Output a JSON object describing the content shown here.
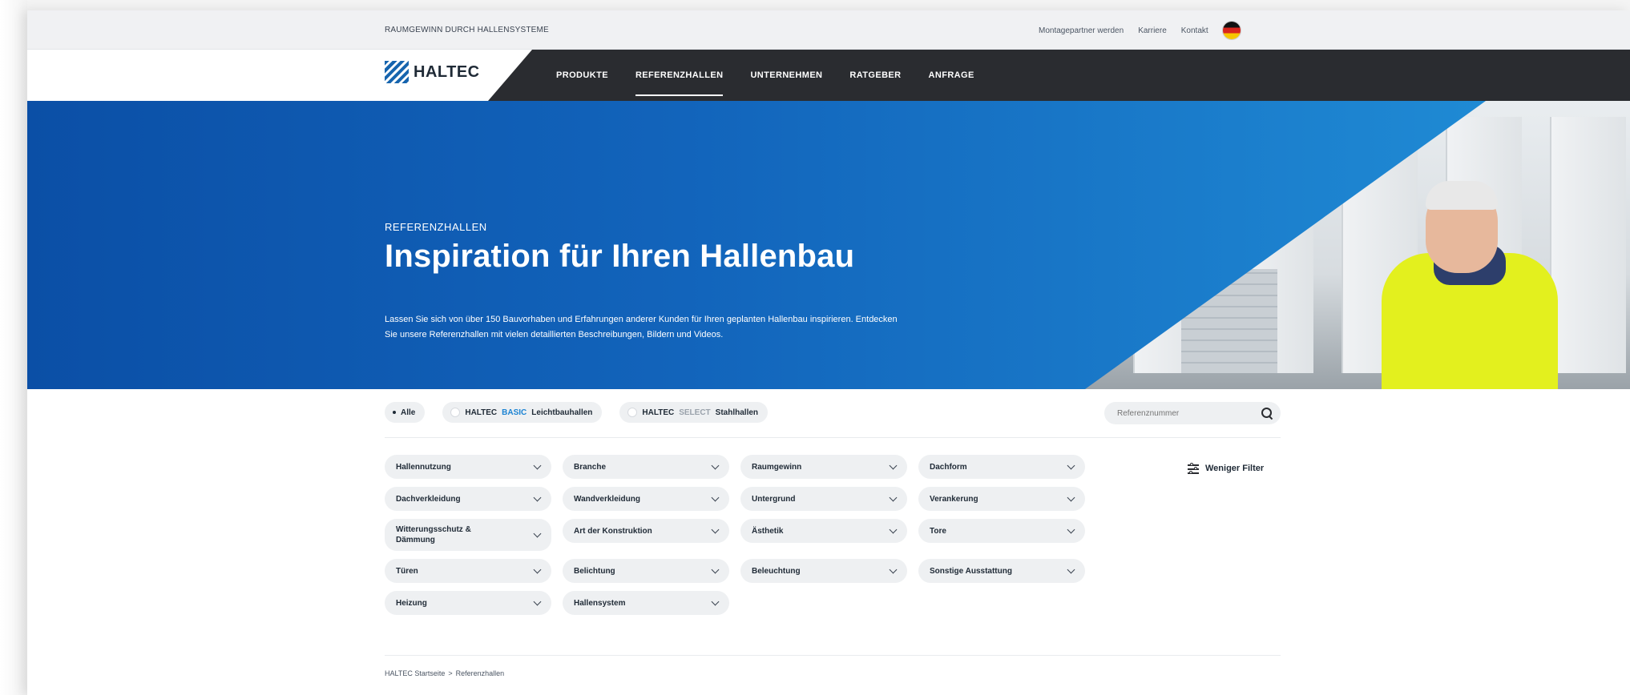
{
  "topbar": {
    "tagline": "RAUMGEWINN DURCH HALLENSYSTEME",
    "links": [
      "Montagepartner werden",
      "Karriere",
      "Kontakt"
    ]
  },
  "nav": {
    "logo_text": "HALTEC",
    "items": [
      "PRODUKTE",
      "REFERENZHALLEN",
      "UNTERNEHMEN",
      "RATGEBER",
      "ANFRAGE"
    ],
    "active": "REFERENZHALLEN"
  },
  "hero": {
    "kicker": "REFERENZHALLEN",
    "title": "Inspiration für Ihren Hallenbau",
    "text": "Lassen Sie sich von über 150 Bauvorhaben und Erfahrungen anderer Kunden für Ihren geplanten Hallenbau inspirieren. Entdecken Sie unsere Referenzhallen mit vielen detaillierten Beschreibungen, Bildern und Videos."
  },
  "filter_chips": {
    "all": "Alle",
    "basic_prefix": "HALTEC",
    "basic_accent": "BASIC",
    "basic_suffix": "Leichtbauhallen",
    "select_prefix": "HALTEC",
    "select_accent": "SELECT",
    "select_suffix": "Stahlhallen"
  },
  "search": {
    "placeholder": "Referenznummer"
  },
  "dropdowns": [
    "Hallennutzung",
    "Branche",
    "Raumgewinn",
    "Dachform",
    "Dachverkleidung",
    "Wandverkleidung",
    "Untergrund",
    "Verankerung",
    "Witterungsschutz & Dämmung",
    "Art der Konstruktion",
    "Ästhetik",
    "Tore",
    "Türen",
    "Belichtung",
    "Beleuchtung",
    "Sonstige Ausstattung",
    "Heizung",
    "Hallensystem"
  ],
  "less_filter": "Weniger Filter",
  "breadcrumb": {
    "home": "HALTEC Startseite",
    "separator": ">",
    "current": "Referenzhallen"
  },
  "colors": {
    "brand_blue": "#1565b8",
    "nav_dark": "#2a2c30",
    "basic_accent": "#1b83d3"
  }
}
